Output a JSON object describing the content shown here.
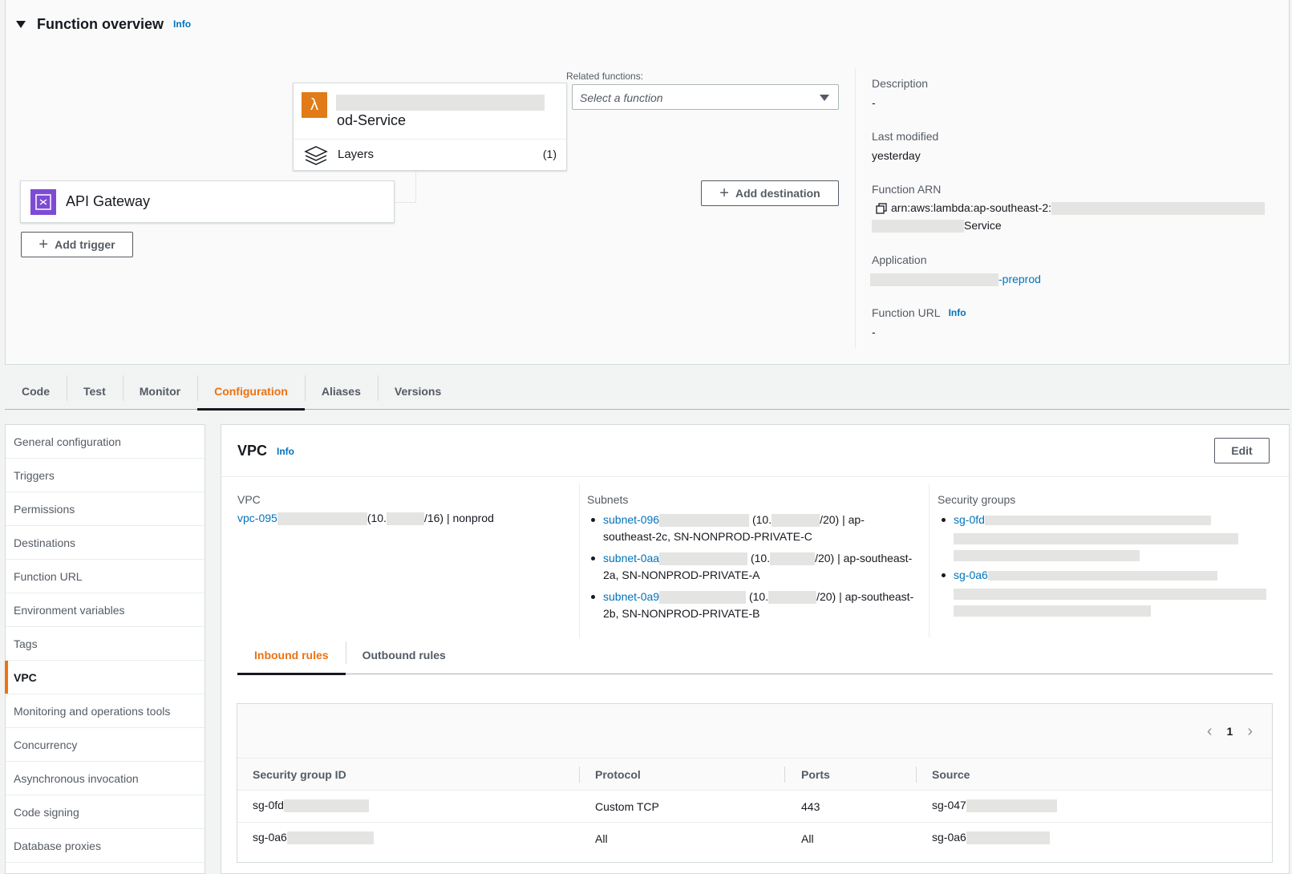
{
  "overview": {
    "title": "Function overview",
    "info_label": "Info",
    "function": {
      "name_suffix": "od-Service"
    },
    "layers": {
      "label": "Layers",
      "count": "(1)"
    },
    "trigger": {
      "label": "API Gateway"
    },
    "add_trigger_label": "Add trigger",
    "add_destination_label": "Add destination",
    "related": {
      "label": "Related functions:",
      "placeholder": "Select a function"
    },
    "details": {
      "description_label": "Description",
      "description_value": "-",
      "last_modified_label": "Last modified",
      "last_modified_value": "yesterday",
      "arn_label": "Function ARN",
      "arn_prefix": "arn:aws:lambda:ap-southeast-2:",
      "arn_suffix": "Service",
      "application_label": "Application",
      "application_suffix": "-preprod",
      "function_url_label": "Function URL",
      "function_url_info": "Info",
      "function_url_value": "-"
    }
  },
  "tabs": [
    "Code",
    "Test",
    "Monitor",
    "Configuration",
    "Aliases",
    "Versions"
  ],
  "active_tab": "Configuration",
  "sidenav": {
    "items": [
      "General configuration",
      "Triggers",
      "Permissions",
      "Destinations",
      "Function URL",
      "Environment variables",
      "Tags",
      "VPC",
      "Monitoring and operations tools",
      "Concurrency",
      "Asynchronous invocation",
      "Code signing",
      "Database proxies"
    ],
    "active": "VPC"
  },
  "vpc_panel": {
    "title": "VPC",
    "info_label": "Info",
    "edit_label": "Edit",
    "vpc": {
      "label": "VPC",
      "id_prefix": "vpc-095",
      "cidr_prefix": "(10.",
      "cidr_suffix": "/16) | nonprod"
    },
    "subnets": {
      "label": "Subnets",
      "items": [
        {
          "id_prefix": "subnet-096",
          "cidr_prefix": "(10.",
          "line1_suffix": "/20) | ap-",
          "line2": "southeast-2c, SN-NONPROD-PRIVATE-C"
        },
        {
          "id_prefix": "subnet-0aa",
          "cidr_prefix": "(10.",
          "line1_suffix": "/20) | ap-southeast-",
          "line2": "2a, SN-NONPROD-PRIVATE-A"
        },
        {
          "id_prefix": "subnet-0a9",
          "cidr_prefix": "(10.",
          "line1_suffix": "/20) | ap-southeast-",
          "line2": "2b, SN-NONPROD-PRIVATE-B"
        }
      ]
    },
    "security_groups": {
      "label": "Security groups",
      "items": [
        {
          "id_prefix": "sg-0fd"
        },
        {
          "id_prefix": "sg-0a6"
        }
      ]
    },
    "rules_tabs": [
      "Inbound rules",
      "Outbound rules"
    ],
    "active_rules_tab": "Inbound rules",
    "pagination": {
      "current_page": "1"
    },
    "table": {
      "headers": [
        "Security group ID",
        "Protocol",
        "Ports",
        "Source"
      ],
      "rows": [
        {
          "sg_prefix": "sg-0fd",
          "protocol": "Custom TCP",
          "ports": "443",
          "source_prefix": "sg-047"
        },
        {
          "sg_prefix": "sg-0a6",
          "protocol": "All",
          "ports": "All",
          "source_prefix": "sg-0a6"
        }
      ]
    }
  }
}
